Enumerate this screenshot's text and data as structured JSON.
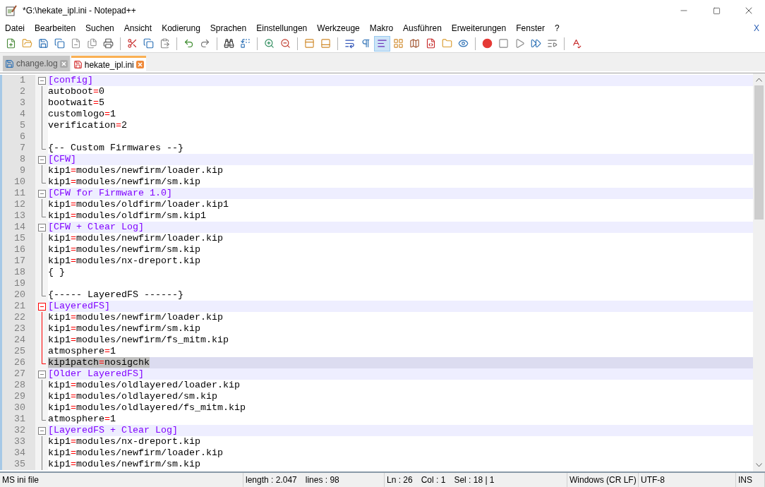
{
  "window": {
    "title": "*G:\\hekate_ipl.ini - Notepad++"
  },
  "menu": {
    "items": [
      "Datei",
      "Bearbeiten",
      "Suchen",
      "Ansicht",
      "Kodierung",
      "Sprachen",
      "Einstellungen",
      "Werkzeuge",
      "Makro",
      "Ausführen",
      "Erweiterungen",
      "Fenster",
      "?"
    ],
    "close_label": "X"
  },
  "tabs": [
    {
      "label": "change.log",
      "selected": false
    },
    {
      "label": "hekate_ipl.ini",
      "selected": true
    }
  ],
  "editor": {
    "lines": [
      {
        "number": "1",
        "kind": "section",
        "text": "[config]",
        "fold_start": true,
        "fold_end": false,
        "active_fold": false,
        "current": false
      },
      {
        "number": "2",
        "kind": "kv",
        "text": "autoboot=0",
        "fold_start": false,
        "fold_end": false,
        "active_fold": false,
        "current": false
      },
      {
        "number": "3",
        "kind": "kv",
        "text": "bootwait=5",
        "fold_start": false,
        "fold_end": false,
        "active_fold": false,
        "current": false
      },
      {
        "number": "4",
        "kind": "kv",
        "text": "customlogo=1",
        "fold_start": false,
        "fold_end": false,
        "active_fold": false,
        "current": false
      },
      {
        "number": "5",
        "kind": "kv",
        "text": "verification=2",
        "fold_start": false,
        "fold_end": false,
        "active_fold": false,
        "current": false
      },
      {
        "number": "6",
        "kind": "plain",
        "fold_start": false,
        "fold_end": false,
        "active_fold": false,
        "current": false
      },
      {
        "number": "7",
        "kind": "plain",
        "text": "{-- Custom Firmwares --}",
        "fold_start": false,
        "fold_end": true,
        "active_fold": false,
        "current": false
      },
      {
        "number": "8",
        "kind": "section",
        "text": "[CFW]",
        "fold_start": true,
        "fold_end": false,
        "active_fold": false,
        "current": false
      },
      {
        "number": "9",
        "kind": "kv",
        "text": "kip1=modules/newfirm/loader.kip",
        "fold_start": false,
        "fold_end": false,
        "active_fold": false,
        "current": false
      },
      {
        "number": "10",
        "kind": "kv",
        "text": "kip1=modules/newfirm/sm.kip",
        "fold_start": false,
        "fold_end": true,
        "active_fold": false,
        "current": false
      },
      {
        "number": "11",
        "kind": "section",
        "text": "[CFW for Firmware 1.0]",
        "fold_start": true,
        "fold_end": false,
        "active_fold": false,
        "current": false
      },
      {
        "number": "12",
        "kind": "kv",
        "text": "kip1=modules/oldfirm/loader.kip1",
        "fold_start": false,
        "fold_end": false,
        "active_fold": false,
        "current": false
      },
      {
        "number": "13",
        "kind": "kv",
        "text": "kip1=modules/oldfirm/sm.kip1",
        "fold_start": false,
        "fold_end": true,
        "active_fold": false,
        "current": false
      },
      {
        "number": "14",
        "kind": "section",
        "text": "[CFW + Clear Log]",
        "fold_start": true,
        "fold_end": false,
        "active_fold": false,
        "current": false
      },
      {
        "number": "15",
        "kind": "kv",
        "text": "kip1=modules/newfirm/loader.kip",
        "fold_start": false,
        "fold_end": false,
        "active_fold": false,
        "current": false
      },
      {
        "number": "16",
        "kind": "kv",
        "text": "kip1=modules/newfirm/sm.kip",
        "fold_start": false,
        "fold_end": false,
        "active_fold": false,
        "current": false
      },
      {
        "number": "17",
        "kind": "kv",
        "text": "kip1=modules/nx-dreport.kip",
        "fold_start": false,
        "fold_end": false,
        "active_fold": false,
        "current": false
      },
      {
        "number": "18",
        "kind": "plain",
        "text": "{ }",
        "fold_start": false,
        "fold_end": false,
        "active_fold": false,
        "current": false
      },
      {
        "number": "19",
        "kind": "plain",
        "fold_start": false,
        "fold_end": false,
        "active_fold": false,
        "current": false
      },
      {
        "number": "20",
        "kind": "plain",
        "text": "{----- LayeredFS ------}",
        "fold_start": false,
        "fold_end": true,
        "active_fold": false,
        "current": false
      },
      {
        "number": "21",
        "kind": "section",
        "text": "[LayeredFS]",
        "fold_start": true,
        "fold_end": false,
        "active_fold": true,
        "current": false
      },
      {
        "number": "22",
        "kind": "kv",
        "text": "kip1=modules/newfirm/loader.kip",
        "fold_start": false,
        "fold_end": false,
        "active_fold": true,
        "current": false
      },
      {
        "number": "23",
        "kind": "kv",
        "text": "kip1=modules/newfirm/sm.kip",
        "fold_start": false,
        "fold_end": false,
        "active_fold": true,
        "current": false
      },
      {
        "number": "24",
        "kind": "kv",
        "text": "kip1=modules/newfirm/fs_mitm.kip",
        "fold_start": false,
        "fold_end": false,
        "active_fold": true,
        "current": false
      },
      {
        "number": "25",
        "kind": "kv",
        "text": "atmosphere=1",
        "fold_start": false,
        "fold_end": false,
        "active_fold": true,
        "current": false
      },
      {
        "number": "26",
        "kind": "kv",
        "text": "kip1patch=nosigchk",
        "fold_start": false,
        "fold_end": true,
        "active_fold": true,
        "current": true
      },
      {
        "number": "27",
        "kind": "section",
        "text": "[Older LayeredFS]",
        "fold_start": true,
        "fold_end": false,
        "active_fold": false,
        "current": false
      },
      {
        "number": "28",
        "kind": "kv",
        "text": "kip1=modules/oldlayered/loader.kip",
        "fold_start": false,
        "fold_end": false,
        "active_fold": false,
        "current": false
      },
      {
        "number": "29",
        "kind": "kv",
        "text": "kip1=modules/oldlayered/sm.kip",
        "fold_start": false,
        "fold_end": false,
        "active_fold": false,
        "current": false
      },
      {
        "number": "30",
        "kind": "kv",
        "text": "kip1=modules/oldlayered/fs_mitm.kip",
        "fold_start": false,
        "fold_end": false,
        "active_fold": false,
        "current": false
      },
      {
        "number": "31",
        "kind": "kv",
        "text": "atmosphere=1",
        "fold_start": false,
        "fold_end": true,
        "active_fold": false,
        "current": false
      },
      {
        "number": "32",
        "kind": "section",
        "text": "[LayeredFS + Clear Log]",
        "fold_start": true,
        "fold_end": false,
        "active_fold": false,
        "current": false
      },
      {
        "number": "33",
        "kind": "kv",
        "text": "kip1=modules/nx-dreport.kip",
        "fold_start": false,
        "fold_end": false,
        "active_fold": false,
        "current": false
      },
      {
        "number": "34",
        "kind": "kv",
        "text": "kip1=modules/newfirm/loader.kip",
        "fold_start": false,
        "fold_end": false,
        "active_fold": false,
        "current": false
      },
      {
        "number": "35",
        "kind": "kv",
        "text": "kip1=modules/newfirm/sm.kip",
        "fold_start": false,
        "fold_end": false,
        "active_fold": false,
        "current": false
      }
    ]
  },
  "status_bar": [
    {
      "texts": [
        "MS ini file"
      ]
    },
    {
      "texts": [
        "length : 2.047",
        "lines : 98"
      ]
    },
    {
      "texts": [
        "Ln : 26",
        "Col : 1",
        "Sel : 18 | 1"
      ]
    },
    {
      "texts": [
        "Windows (CR LF)"
      ]
    },
    {
      "texts": [
        "UTF-8"
      ]
    },
    {
      "texts": [
        "INS"
      ]
    }
  ]
}
